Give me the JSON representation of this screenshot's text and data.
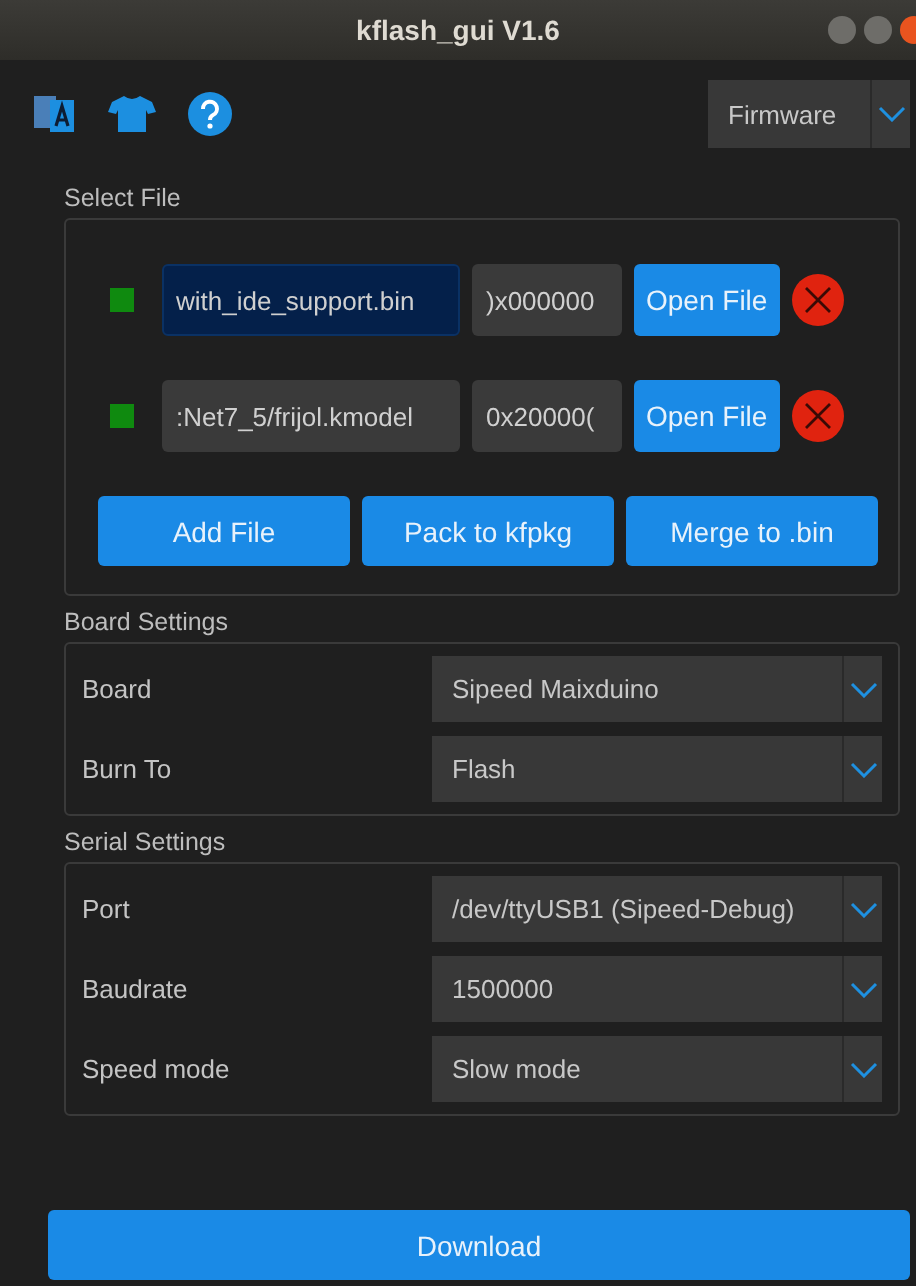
{
  "window": {
    "title": "kflash_gui V1.6"
  },
  "mode_select": {
    "value": "Firmware"
  },
  "select_file": {
    "title": "Select File",
    "files": [
      {
        "checked": true,
        "path": "with_ide_support.bin",
        "focused": true,
        "address": ")x000000",
        "button": "Open File"
      },
      {
        "checked": true,
        "path": ":Net7_5/frijol.kmodel",
        "focused": false,
        "address": "0x20000(",
        "button": "Open File"
      }
    ],
    "actions": [
      "Add File",
      "Pack to kfpkg",
      "Merge to .bin"
    ]
  },
  "board_settings": {
    "title": "Board Settings",
    "rows": [
      {
        "label": "Board",
        "value": "Sipeed Maixduino"
      },
      {
        "label": "Burn To",
        "value": "Flash"
      }
    ]
  },
  "serial_settings": {
    "title": "Serial Settings",
    "rows": [
      {
        "label": "Port",
        "value": "/dev/ttyUSB1 (Sipeed-Debug)"
      },
      {
        "label": "Baudrate",
        "value": "1500000"
      },
      {
        "label": "Speed mode",
        "value": "Slow mode"
      }
    ]
  },
  "download_button": "Download"
}
